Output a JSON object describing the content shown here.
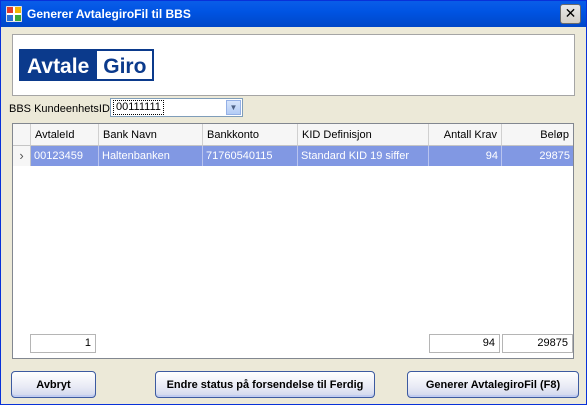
{
  "window": {
    "title": "Generer AvtalegiroFil til BBS",
    "close_symbol": "✕"
  },
  "logo": {
    "part1": "Avtale",
    "part2": "Giro"
  },
  "kunde": {
    "label": "BBS KundeenhetsID",
    "value": "00111111"
  },
  "grid": {
    "columns": [
      "AvtaleId",
      "Bank Navn",
      "Bankkonto",
      "KID Definisjon",
      "Antall Krav",
      "Beløp"
    ],
    "rows": [
      {
        "indicator": "›",
        "cells": [
          "00123459",
          "Haltenbanken",
          "71760540115",
          "Standard KID 19 siffer",
          "94",
          "29875"
        ]
      }
    ],
    "footer": {
      "count": "1",
      "antall_krav": "94",
      "belop": "29875"
    }
  },
  "buttons": {
    "cancel": "Avbryt",
    "status": "Endre status på forsendelse til Ferdig",
    "generate": "Generer AvtalegiroFil (F8)"
  },
  "colors": {
    "titlebar": "#0054e3",
    "selection": "#8198e3",
    "logo": "#0b3a8c"
  }
}
